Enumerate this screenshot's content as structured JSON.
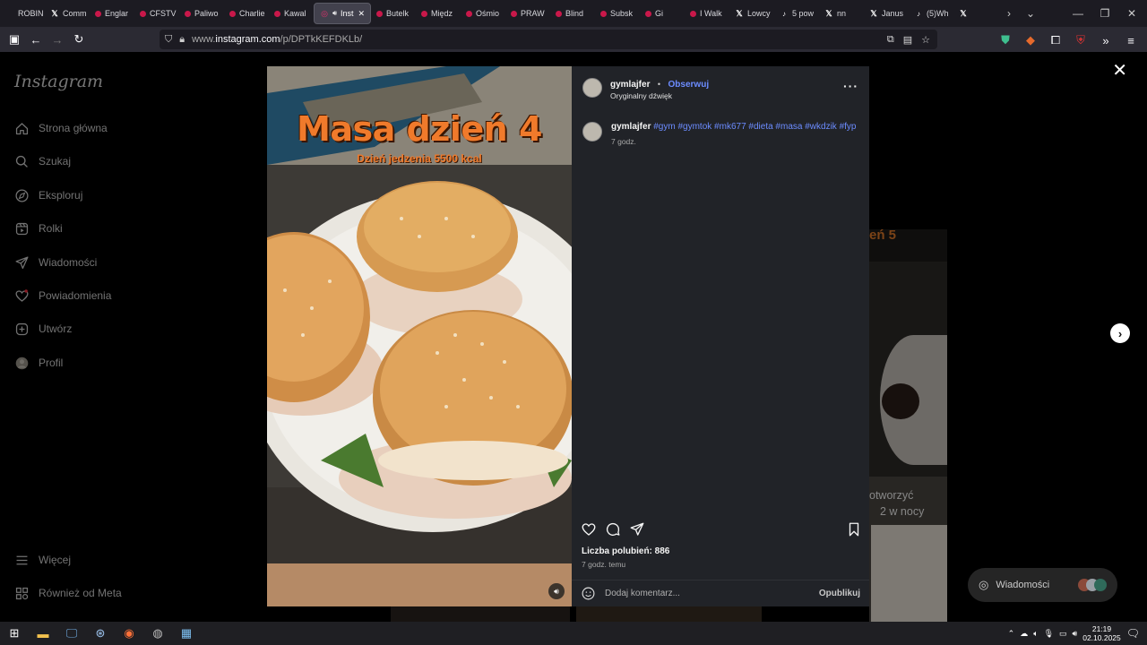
{
  "browser": {
    "tabs": [
      {
        "label": "ROBIN",
        "icon": "generic"
      },
      {
        "label": "Comm",
        "icon": "x"
      },
      {
        "label": "Englar",
        "icon": "youtube"
      },
      {
        "label": "CFSTV",
        "icon": "youtube"
      },
      {
        "label": "Paliwo",
        "icon": "youtube"
      },
      {
        "label": "Charlie",
        "icon": "youtube"
      },
      {
        "label": "Kawal",
        "icon": "youtube"
      },
      {
        "label": "Inst",
        "icon": "instagram",
        "active": true
      },
      {
        "label": "Butelk",
        "icon": "youtube"
      },
      {
        "label": "Międz",
        "icon": "youtube"
      },
      {
        "label": "Ośmio",
        "icon": "youtube"
      },
      {
        "label": "PRAW",
        "icon": "youtube"
      },
      {
        "label": "Blind",
        "icon": "youtube"
      },
      {
        "label": "Subsk",
        "icon": "youtube"
      },
      {
        "label": "Gi",
        "icon": "youtube"
      },
      {
        "label": "I Walk",
        "icon": "youtube"
      },
      {
        "label": "Lowcy",
        "icon": "x"
      },
      {
        "label": "5 pow",
        "icon": "tiktok"
      },
      {
        "label": "nn",
        "icon": "x"
      },
      {
        "label": "Janus",
        "icon": "x"
      },
      {
        "label": "(5)Wh",
        "icon": "tiktok"
      },
      {
        "label": "",
        "icon": "x"
      }
    ],
    "url_prefix": "www.",
    "url_host": "instagram.com",
    "url_path": "/p/DPTkKEFDKLb/",
    "accent": "#2b2a33"
  },
  "sidebar": {
    "logo": "Instagram",
    "items": [
      {
        "label": "Strona główna",
        "icon": "home-icon"
      },
      {
        "label": "Szukaj",
        "icon": "search-icon"
      },
      {
        "label": "Eksploruj",
        "icon": "compass-icon"
      },
      {
        "label": "Rolki",
        "icon": "reels-icon"
      },
      {
        "label": "Wiadomości",
        "icon": "send-icon"
      },
      {
        "label": "Powiadomienia",
        "icon": "heart-icon"
      },
      {
        "label": "Utwórz",
        "icon": "plus-icon"
      },
      {
        "label": "Profil",
        "icon": "avatar"
      }
    ],
    "more": "Więcej",
    "meta": "Również od Meta"
  },
  "post": {
    "overlay_title": "Masa dzień 4",
    "overlay_subtitle": "Dzień jedzenia 5500 kcal",
    "username": "gymlajfer",
    "separator": "•",
    "follow": "Obserwuj",
    "audio": "Oryginalny dźwięk",
    "caption_user": "gymlajfer",
    "caption_tags": "#gym #gymtok #mk677 #dieta #masa #wkdzik #fyp",
    "caption_age": "7 godz.",
    "likes": "Liczba polubień: 886",
    "posted_ago": "7 godz. temu",
    "comment_placeholder": "Dodaj komentarz...",
    "publish": "Opublikuj"
  },
  "background": {
    "snippet_line1": "otworzyć",
    "snippet_line2": "2 w nocy",
    "snippet_top": "eń 5"
  },
  "messages_pill": "Wiadomości",
  "taskbar": {
    "time": "21:19",
    "date": "02.10.2025"
  }
}
